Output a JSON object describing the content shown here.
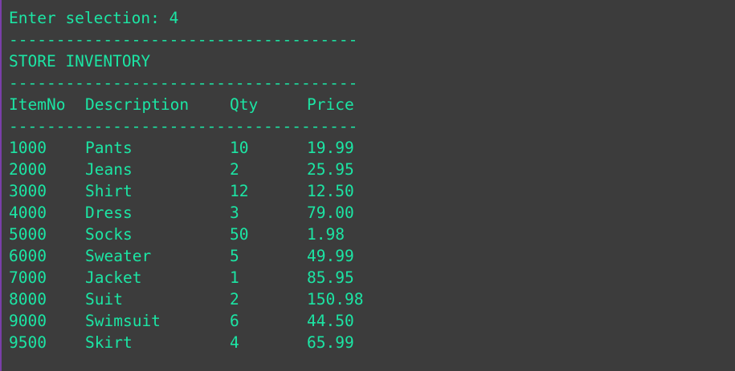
{
  "terminal": {
    "prompt": "Enter selection: 4",
    "divider": "-------------------------------------",
    "title": "STORE INVENTORY",
    "headers": [
      "ItemNo",
      "Description",
      "Qty",
      "Price"
    ],
    "rows": [
      [
        "1000",
        "Pants",
        "10",
        "19.99"
      ],
      [
        "2000",
        "Jeans",
        "2",
        "25.95"
      ],
      [
        "3000",
        "Shirt",
        "12",
        "12.50"
      ],
      [
        "4000",
        "Dress",
        "3",
        "79.00"
      ],
      [
        "5000",
        "Socks",
        "50",
        "1.98"
      ],
      [
        "6000",
        "Sweater",
        "5",
        "49.99"
      ],
      [
        "7000",
        "Jacket",
        "1",
        "85.95"
      ],
      [
        "8000",
        "Suit",
        "2",
        "150.98"
      ],
      [
        "9000",
        "Swimsuit",
        "6",
        "44.50"
      ],
      [
        "9500",
        "Skirt",
        "4",
        "65.99"
      ]
    ]
  },
  "colors": {
    "background": "#3c3c3c",
    "text": "#1ce5a4",
    "window_edge": "#7a3fa8"
  }
}
